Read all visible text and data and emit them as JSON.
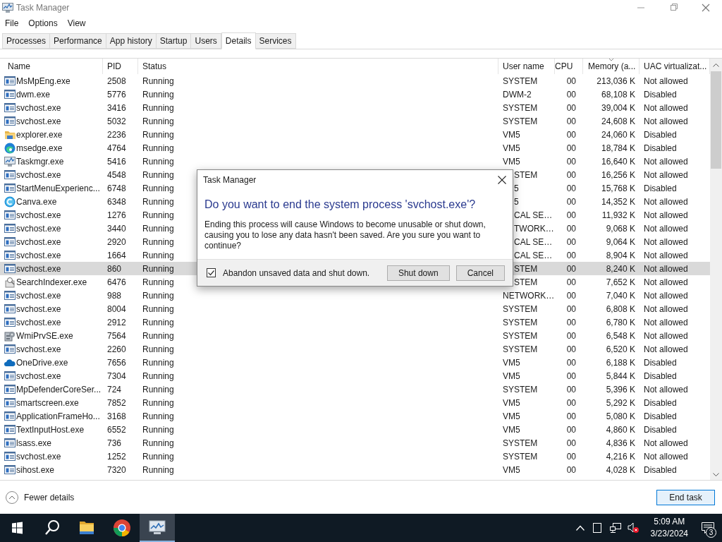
{
  "window": {
    "title": "Task Manager"
  },
  "menu": [
    "File",
    "Options",
    "View"
  ],
  "tabs": [
    {
      "label": "Processes",
      "selected": false
    },
    {
      "label": "Performance",
      "selected": false
    },
    {
      "label": "App history",
      "selected": false
    },
    {
      "label": "Startup",
      "selected": false
    },
    {
      "label": "Users",
      "selected": false
    },
    {
      "label": "Details",
      "selected": true
    },
    {
      "label": "Services",
      "selected": false
    }
  ],
  "table": {
    "columns": [
      {
        "label": "Name",
        "sorted": false
      },
      {
        "label": "PID",
        "sorted": false
      },
      {
        "label": "Status",
        "sorted": false
      },
      {
        "label": "User name",
        "sorted": false
      },
      {
        "label": "CPU",
        "sorted": false
      },
      {
        "label": "Memory (a...",
        "sorted": true
      },
      {
        "label": "UAC virtualizat...",
        "sorted": false
      }
    ],
    "rows": [
      {
        "kind": "app",
        "name": "MsMpEng.exe",
        "pid": "2508",
        "status": "Running",
        "user": "SYSTEM",
        "user_covered": false,
        "cpu": "00",
        "memory": "213,036 K",
        "uac": "Not allowed",
        "selected": false
      },
      {
        "kind": "app",
        "name": "dwm.exe",
        "pid": "5776",
        "status": "Running",
        "user": "DWM-2",
        "user_covered": false,
        "cpu": "00",
        "memory": "68,108 K",
        "uac": "Disabled",
        "selected": false
      },
      {
        "kind": "app",
        "name": "svchost.exe",
        "pid": "3416",
        "status": "Running",
        "user": "SYSTEM",
        "user_covered": false,
        "cpu": "00",
        "memory": "39,004 K",
        "uac": "Not allowed",
        "selected": false
      },
      {
        "kind": "app",
        "name": "svchost.exe",
        "pid": "5032",
        "status": "Running",
        "user": "SYSTEM",
        "user_covered": false,
        "cpu": "00",
        "memory": "24,608 K",
        "uac": "Not allowed",
        "selected": false
      },
      {
        "kind": "folder",
        "name": "explorer.exe",
        "pid": "2236",
        "status": "Running",
        "user": "VM5",
        "user_covered": false,
        "cpu": "00",
        "memory": "24,060 K",
        "uac": "Disabled",
        "selected": false
      },
      {
        "kind": "edge",
        "name": "msedge.exe",
        "pid": "4764",
        "status": "Running",
        "user": "VM5",
        "user_covered": false,
        "cpu": "00",
        "memory": "18,784 K",
        "uac": "Disabled",
        "selected": false
      },
      {
        "kind": "monitor",
        "name": "Taskmgr.exe",
        "pid": "5416",
        "status": "Running",
        "user": "VM5",
        "user_covered": false,
        "cpu": "00",
        "memory": "16,640 K",
        "uac": "Not allowed",
        "selected": false
      },
      {
        "kind": "app",
        "name": "svchost.exe",
        "pid": "4548",
        "status": "Running",
        "user": "STEM",
        "user_covered": true,
        "cpu": "00",
        "memory": "16,256 K",
        "uac": "Not allowed",
        "selected": false
      },
      {
        "kind": "app",
        "name": "StartMenuExperienc...",
        "pid": "6748",
        "status": "Running",
        "user": "5",
        "user_covered": true,
        "cpu": "00",
        "memory": "15,768 K",
        "uac": "Disabled",
        "selected": false
      },
      {
        "kind": "canva",
        "name": "Canva.exe",
        "pid": "6348",
        "status": "Running",
        "user": "5",
        "user_covered": true,
        "cpu": "00",
        "memory": "14,352 K",
        "uac": "Not allowed",
        "selected": false
      },
      {
        "kind": "app",
        "name": "svchost.exe",
        "pid": "1276",
        "status": "Running",
        "user": "CAL SE…",
        "user_covered": true,
        "cpu": "00",
        "memory": "11,932 K",
        "uac": "Not allowed",
        "selected": false
      },
      {
        "kind": "app",
        "name": "svchost.exe",
        "pid": "3440",
        "status": "Running",
        "user": "TWORK…",
        "user_covered": true,
        "cpu": "00",
        "memory": "9,068 K",
        "uac": "Not allowed",
        "selected": false
      },
      {
        "kind": "app",
        "name": "svchost.exe",
        "pid": "2920",
        "status": "Running",
        "user": "CAL SE…",
        "user_covered": true,
        "cpu": "00",
        "memory": "9,064 K",
        "uac": "Not allowed",
        "selected": false
      },
      {
        "kind": "app",
        "name": "svchost.exe",
        "pid": "1664",
        "status": "Running",
        "user": "CAL SE…",
        "user_covered": true,
        "cpu": "00",
        "memory": "8,904 K",
        "uac": "Not allowed",
        "selected": false
      },
      {
        "kind": "app",
        "name": "svchost.exe",
        "pid": "860",
        "status": "Running",
        "user": "STEM",
        "user_covered": true,
        "cpu": "00",
        "memory": "8,240 K",
        "uac": "Not allowed",
        "selected": true
      },
      {
        "kind": "search",
        "name": "SearchIndexer.exe",
        "pid": "6476",
        "status": "Running",
        "user": "STEM",
        "user_covered": true,
        "cpu": "00",
        "memory": "7,652 K",
        "uac": "Not allowed",
        "selected": false
      },
      {
        "kind": "app",
        "name": "svchost.exe",
        "pid": "988",
        "status": "Running",
        "user": "NETWORK…",
        "user_covered": false,
        "cpu": "00",
        "memory": "7,040 K",
        "uac": "Not allowed",
        "selected": false
      },
      {
        "kind": "app",
        "name": "svchost.exe",
        "pid": "8004",
        "status": "Running",
        "user": "SYSTEM",
        "user_covered": false,
        "cpu": "00",
        "memory": "6,808 K",
        "uac": "Not allowed",
        "selected": false
      },
      {
        "kind": "app",
        "name": "svchost.exe",
        "pid": "2912",
        "status": "Running",
        "user": "SYSTEM",
        "user_covered": false,
        "cpu": "00",
        "memory": "6,780 K",
        "uac": "Not allowed",
        "selected": false
      },
      {
        "kind": "gears",
        "name": "WmiPrvSE.exe",
        "pid": "7564",
        "status": "Running",
        "user": "SYSTEM",
        "user_covered": false,
        "cpu": "00",
        "memory": "6,548 K",
        "uac": "Not allowed",
        "selected": false
      },
      {
        "kind": "app",
        "name": "svchost.exe",
        "pid": "2260",
        "status": "Running",
        "user": "SYSTEM",
        "user_covered": false,
        "cpu": "00",
        "memory": "6,520 K",
        "uac": "Not allowed",
        "selected": false
      },
      {
        "kind": "cloud",
        "name": "OneDrive.exe",
        "pid": "7656",
        "status": "Running",
        "user": "VM5",
        "user_covered": false,
        "cpu": "00",
        "memory": "6,188 K",
        "uac": "Disabled",
        "selected": false
      },
      {
        "kind": "app",
        "name": "svchost.exe",
        "pid": "7304",
        "status": "Running",
        "user": "VM5",
        "user_covered": false,
        "cpu": "00",
        "memory": "5,844 K",
        "uac": "Disabled",
        "selected": false
      },
      {
        "kind": "app",
        "name": "MpDefenderCoreSer...",
        "pid": "724",
        "status": "Running",
        "user": "SYSTEM",
        "user_covered": false,
        "cpu": "00",
        "memory": "5,396 K",
        "uac": "Not allowed",
        "selected": false
      },
      {
        "kind": "app",
        "name": "smartscreen.exe",
        "pid": "7852",
        "status": "Running",
        "user": "VM5",
        "user_covered": false,
        "cpu": "00",
        "memory": "5,292 K",
        "uac": "Disabled",
        "selected": false
      },
      {
        "kind": "app",
        "name": "ApplicationFrameHo...",
        "pid": "3168",
        "status": "Running",
        "user": "VM5",
        "user_covered": false,
        "cpu": "00",
        "memory": "5,080 K",
        "uac": "Disabled",
        "selected": false
      },
      {
        "kind": "app",
        "name": "TextInputHost.exe",
        "pid": "6552",
        "status": "Running",
        "user": "VM5",
        "user_covered": false,
        "cpu": "00",
        "memory": "4,860 K",
        "uac": "Disabled",
        "selected": false
      },
      {
        "kind": "app",
        "name": "lsass.exe",
        "pid": "736",
        "status": "Running",
        "user": "SYSTEM",
        "user_covered": false,
        "cpu": "00",
        "memory": "4,836 K",
        "uac": "Not allowed",
        "selected": false
      },
      {
        "kind": "app",
        "name": "svchost.exe",
        "pid": "1252",
        "status": "Running",
        "user": "SYSTEM",
        "user_covered": false,
        "cpu": "00",
        "memory": "4,216 K",
        "uac": "Not allowed",
        "selected": false
      },
      {
        "kind": "app",
        "name": "sihost.exe",
        "pid": "7320",
        "status": "Running",
        "user": "VM5",
        "user_covered": false,
        "cpu": "00",
        "memory": "4,028 K",
        "uac": "Disabled",
        "selected": false
      }
    ]
  },
  "dialog": {
    "title": "Task Manager",
    "heading": "Do you want to end the system process 'svchost.exe'?",
    "message": "Ending this process will cause Windows to become unusable or shut down, causing you to lose any data hasn't been saved. Are you sure you want to continue?",
    "checkbox": {
      "label": "Abandon unsaved data and shut down.",
      "checked": true
    },
    "buttons": [
      "Shut down",
      "Cancel"
    ]
  },
  "footer": {
    "toggle": "Fewer details",
    "button": "End task"
  },
  "taskbar": {
    "apps": [
      {
        "kind": "search",
        "active": false
      },
      {
        "kind": "folder",
        "active": false
      },
      {
        "kind": "chrome",
        "active": false
      },
      {
        "kind": "monitor",
        "active": true
      }
    ],
    "time": "5:09 AM",
    "date": "3/23/2024",
    "notifications": "3"
  }
}
